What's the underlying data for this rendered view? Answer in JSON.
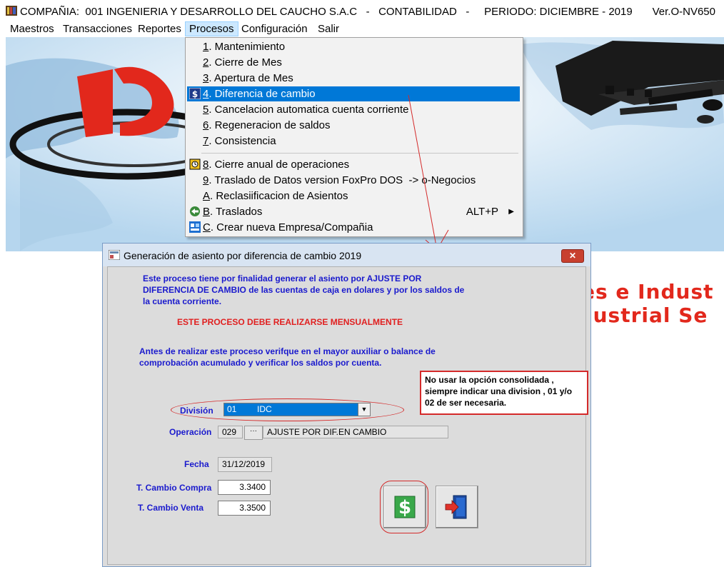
{
  "window": {
    "title": "COMPAÑIA:  001 INGENIERIA Y DESARROLLO DEL CAUCHO S.A.C   -   CONTABILIDAD   -     PERIODO: DICIEMBRE - 2019",
    "version": "Ver.O-NV650"
  },
  "menubar": {
    "items": [
      {
        "label": "Maestros"
      },
      {
        "label": "Transacciones"
      },
      {
        "label": "Reportes"
      },
      {
        "label": "Procesos"
      },
      {
        "label": "Configuración"
      },
      {
        "label": "Salir"
      }
    ]
  },
  "procesos_menu": {
    "items": [
      {
        "key": "1",
        "label": ". Mantenimiento"
      },
      {
        "key": "2",
        "label": ". Cierre de Mes"
      },
      {
        "key": "3",
        "label": ". Apertura de Mes"
      },
      {
        "key": "4",
        "label": ". Diferencia de cambio"
      },
      {
        "key": "5",
        "label": ". Cancelacion automatica cuenta corriente"
      },
      {
        "key": "6",
        "label": ". Regeneracion de saldos"
      },
      {
        "key": "7",
        "label": ". Consistencia"
      },
      {
        "key": "8",
        "label": ". Cierre anual de operaciones"
      },
      {
        "key": "9",
        "label": ". Traslado de Datos version FoxPro DOS  -> o-Negocios"
      },
      {
        "key": "A",
        "label": ". Reclasiificacion de Asientos"
      },
      {
        "key": "B",
        "label": ". Traslados",
        "shortcut": "ALT+P"
      },
      {
        "key": "C",
        "label": ". Crear nueva Empresa/Compañia"
      }
    ]
  },
  "background": {
    "text_line1": "es e Indust",
    "text_line2": "lustrial Se"
  },
  "dialog": {
    "title": "Generación de asiento por diferencia de cambio  2019",
    "close_label": "✕",
    "intro": [
      "Este proceso tiene por finalidad generar el asiento por AJUSTE POR",
      "DIFERENCIA DE CAMBIO de las cuentas de caja en dolares y por los saldos de",
      "la cuenta corriente."
    ],
    "warning": "ESTE PROCESO DEBE  REALIZARSE MENSUALMENTE",
    "instructions": [
      "Antes de realizar este proceso verifque en el mayor auxiliar o balance de",
      "comprobación acumulado y verificar los saldos por cuenta."
    ],
    "note": [
      "No usar la opción consolidada ,",
      "siempre indicar una division , 01 y/o",
      "02 de ser necesaria."
    ],
    "division_label": "División",
    "division_code": "01",
    "division_name": "IDC",
    "operacion_label": "Operación",
    "operacion_code": "029",
    "operacion_button": "···",
    "operacion_desc": "AJUSTE POR DIF.EN CAMBIO",
    "fecha_label": "Fecha",
    "fecha_value": "31/12/2019",
    "tc_compra_label": "T. Cambio Compra",
    "tc_compra_value": "3.3400",
    "tc_venta_label": "T. Cambio   Venta",
    "tc_venta_value": "3.3500"
  },
  "colors": {
    "accent": "#0078d7",
    "note_border": "#d42a2a",
    "label_blue": "#1a1acd",
    "warning_red": "#e02020",
    "brand_red": "#e2281c"
  }
}
